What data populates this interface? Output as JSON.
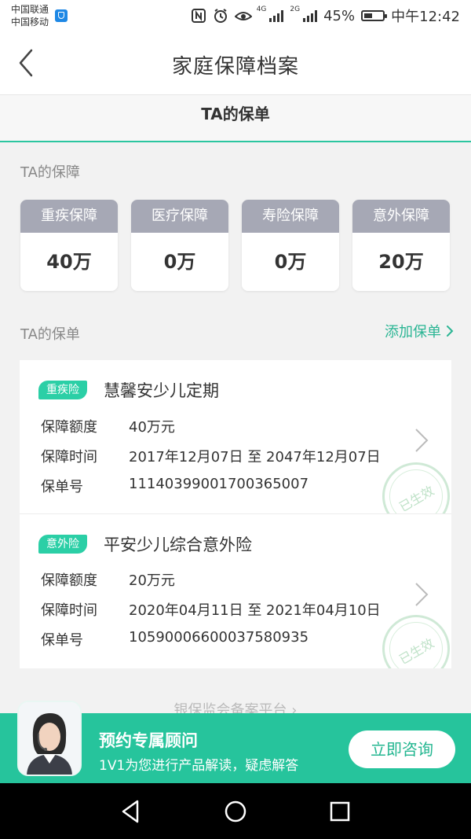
{
  "status_bar": {
    "carrier_1": "中国联通",
    "carrier_2": "中国移动",
    "net_1": "4G",
    "net_2": "2G",
    "battery": "45%",
    "battery_level": 0.45,
    "time": "中午12:42"
  },
  "header": {
    "title": "家庭保障档案"
  },
  "section_tab": {
    "label": "TA的保单"
  },
  "coverage": {
    "label": "TA的保障",
    "cards": [
      {
        "name": "重疾保障",
        "value": "40万"
      },
      {
        "name": "医疗保障",
        "value": "0万"
      },
      {
        "name": "寿险保障",
        "value": "0万"
      },
      {
        "name": "意外保障",
        "value": "20万"
      }
    ]
  },
  "policies": {
    "label": "TA的保单",
    "add_label": "添加保单",
    "field_amount": "保障额度",
    "field_period": "保障时间",
    "field_number": "保单号",
    "items": [
      {
        "tag": "重疾险",
        "name": "慧馨安少儿定期",
        "amount": "40万元",
        "period": "2017年12月07日 至 2047年12月07日",
        "number": "11140399001700365007",
        "stamp": "已生效"
      },
      {
        "tag": "意外险",
        "name": "平安少儿综合意外险",
        "amount": "20万元",
        "period": "2020年04月11日 至 2021年04月10日",
        "number": "10590006600037580935",
        "stamp": "已生效"
      }
    ]
  },
  "footer_link": "银保监会备案平台",
  "banner": {
    "title": "预约专属顾问",
    "subtitle": "1V1为您进行产品解读，疑虑解答",
    "button": "立即咨询"
  },
  "colors": {
    "accent": "#26c49c",
    "coverage_header": "#a6a8b5"
  }
}
